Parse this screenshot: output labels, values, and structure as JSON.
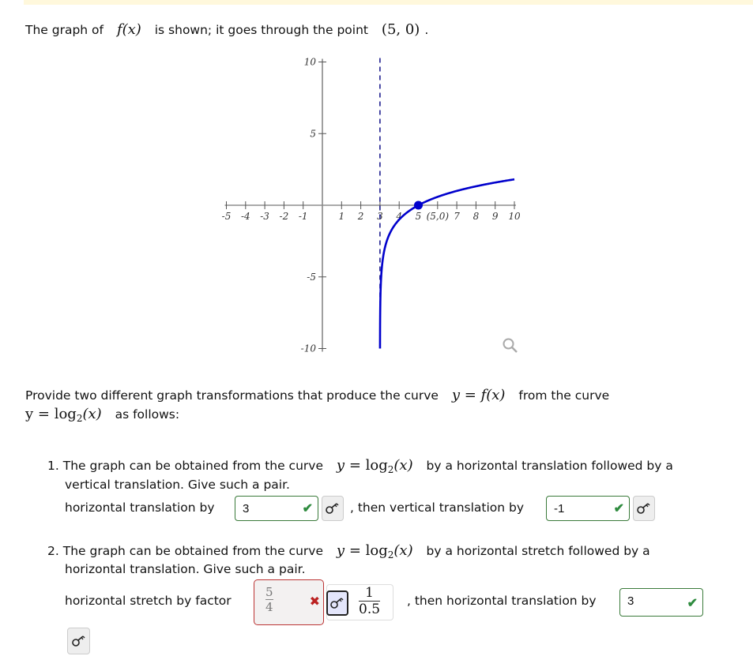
{
  "banner_color": "#fff8dc",
  "intro": {
    "prefix": "The graph of",
    "func": "f(x)",
    "middle": "is shown; it goes through the point",
    "point": "(5, 0)",
    "suffix": "."
  },
  "chart_data": {
    "type": "line",
    "function": "f(x) = log2(x - 3) - 1",
    "xlim": [
      -5,
      10
    ],
    "ylim": [
      -10,
      10
    ],
    "x_ticks": [
      "-5",
      "-4",
      "-3",
      "-2",
      "-1",
      "1",
      "2",
      "3",
      "4",
      "5",
      "(5,0)",
      "7",
      "8",
      "9",
      "10"
    ],
    "x_tick_values": [
      -5,
      -4,
      -3,
      -2,
      -1,
      1,
      2,
      3,
      4,
      5,
      6,
      7,
      8,
      9,
      10
    ],
    "y_ticks": [
      "10",
      "5",
      "-5",
      "-10"
    ],
    "y_tick_values": [
      10,
      5,
      -5,
      -10
    ],
    "asymptote_x": 3,
    "marked_point": {
      "x": 5,
      "y": 0,
      "label": "(5,0)"
    },
    "curve_color": "#0000cc",
    "asymptote_color": "#000080",
    "zoom_icon": "magnifier-icon"
  },
  "prompt": {
    "line1_prefix": "Provide two different graph transformations that produce the curve",
    "line1_math": "y = f(x)",
    "line1_suffix": "from the curve",
    "line2_math_y": "y = log",
    "line2_math_sub": "2",
    "line2_math_arg": "(x)",
    "line2_suffix": "as follows:"
  },
  "q1": {
    "number": "1.",
    "text_a": "The graph can be obtained from the curve",
    "text_b": "by a horizontal translation followed by a",
    "text_c": "vertical translation.   Give such a pair.",
    "label1": "horizontal translation by",
    "answer1": "3",
    "answer1_status": "correct",
    "label2": ", then vertical translation by",
    "answer2": "-1",
    "answer2_status": "correct"
  },
  "q2": {
    "number": "2.",
    "text_a": "The graph can be obtained from the curve",
    "text_b": "by a horizontal stretch followed by a",
    "text_c": "horizontal translation.   Give such a pair.",
    "label1": "horizontal stretch by factor",
    "answer1_num": "5",
    "answer1_den": "4",
    "answer1_status": "incorrect",
    "key_num": "1",
    "key_den": "0.5",
    "label2": ", then horizontal translation by",
    "answer2": "3",
    "answer2_status": "correct"
  },
  "math_log": {
    "y": "y = log",
    "sub": "2",
    "arg": "(x)"
  },
  "icons": {
    "check": "✔",
    "cross": "✖"
  }
}
